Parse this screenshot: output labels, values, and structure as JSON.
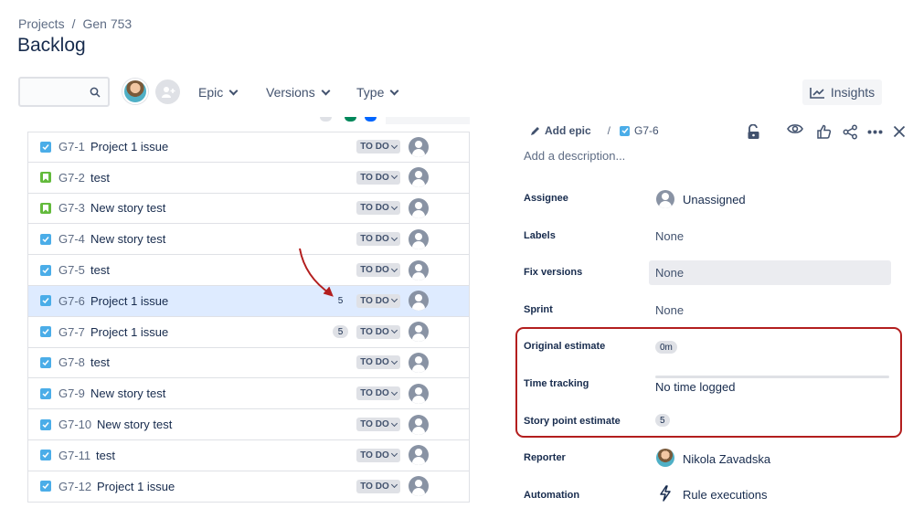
{
  "breadcrumb": {
    "project": "Projects",
    "separator": "/",
    "board": "Gen 753"
  },
  "page_title": "Backlog",
  "toolbar": {
    "search_placeholder": "",
    "filters": [
      "Epic",
      "Versions",
      "Type"
    ],
    "insights_label": "Insights"
  },
  "backlog": [
    {
      "key": "G7-1",
      "summary": "Project 1 issue",
      "type": "task",
      "points": "",
      "status": "TO DO"
    },
    {
      "key": "G7-2",
      "summary": "test",
      "type": "story",
      "points": "",
      "status": "TO DO"
    },
    {
      "key": "G7-3",
      "summary": "New story test",
      "type": "story",
      "points": "",
      "status": "TO DO"
    },
    {
      "key": "G7-4",
      "summary": "New story test",
      "type": "task",
      "points": "",
      "status": "TO DO"
    },
    {
      "key": "G7-5",
      "summary": "test",
      "type": "task",
      "points": "",
      "status": "TO DO"
    },
    {
      "key": "G7-6",
      "summary": "Project 1 issue",
      "type": "task",
      "points": "5",
      "status": "TO DO",
      "selected": true
    },
    {
      "key": "G7-7",
      "summary": "Project 1 issue",
      "type": "task",
      "points": "5",
      "status": "TO DO"
    },
    {
      "key": "G7-8",
      "summary": "test",
      "type": "task",
      "points": "",
      "status": "TO DO"
    },
    {
      "key": "G7-9",
      "summary": "New story test",
      "type": "task",
      "points": "",
      "status": "TO DO"
    },
    {
      "key": "G7-10",
      "summary": "New story test",
      "type": "task",
      "points": "",
      "status": "TO DO"
    },
    {
      "key": "G7-11",
      "summary": "test",
      "type": "task",
      "points": "",
      "status": "TO DO"
    },
    {
      "key": "G7-12",
      "summary": "Project 1 issue",
      "type": "task",
      "points": "",
      "status": "TO DO"
    }
  ],
  "detail": {
    "add_epic_label": "Add epic",
    "separator": "/",
    "issue_key": "G7-6",
    "description_placeholder": "Add a description...",
    "fields": {
      "assignee": {
        "label": "Assignee",
        "value": "Unassigned"
      },
      "labels": {
        "label": "Labels",
        "value": "None"
      },
      "fix_versions": {
        "label": "Fix versions",
        "value": "None"
      },
      "sprint": {
        "label": "Sprint",
        "value": "None"
      },
      "original_estimate": {
        "label": "Original estimate",
        "value": "0m"
      },
      "time_tracking": {
        "label": "Time tracking",
        "value": "No time logged"
      },
      "story_point_estimate": {
        "label": "Story point estimate",
        "value": "5"
      },
      "reporter": {
        "label": "Reporter",
        "value": "Nikola Zavadska"
      },
      "automation": {
        "label": "Automation",
        "value": "Rule executions"
      }
    }
  },
  "colors": {
    "highlight": "#b31e1e",
    "task_icon": "#4bade8",
    "story_icon": "#63ba3c",
    "selected_row": "#deebff"
  }
}
